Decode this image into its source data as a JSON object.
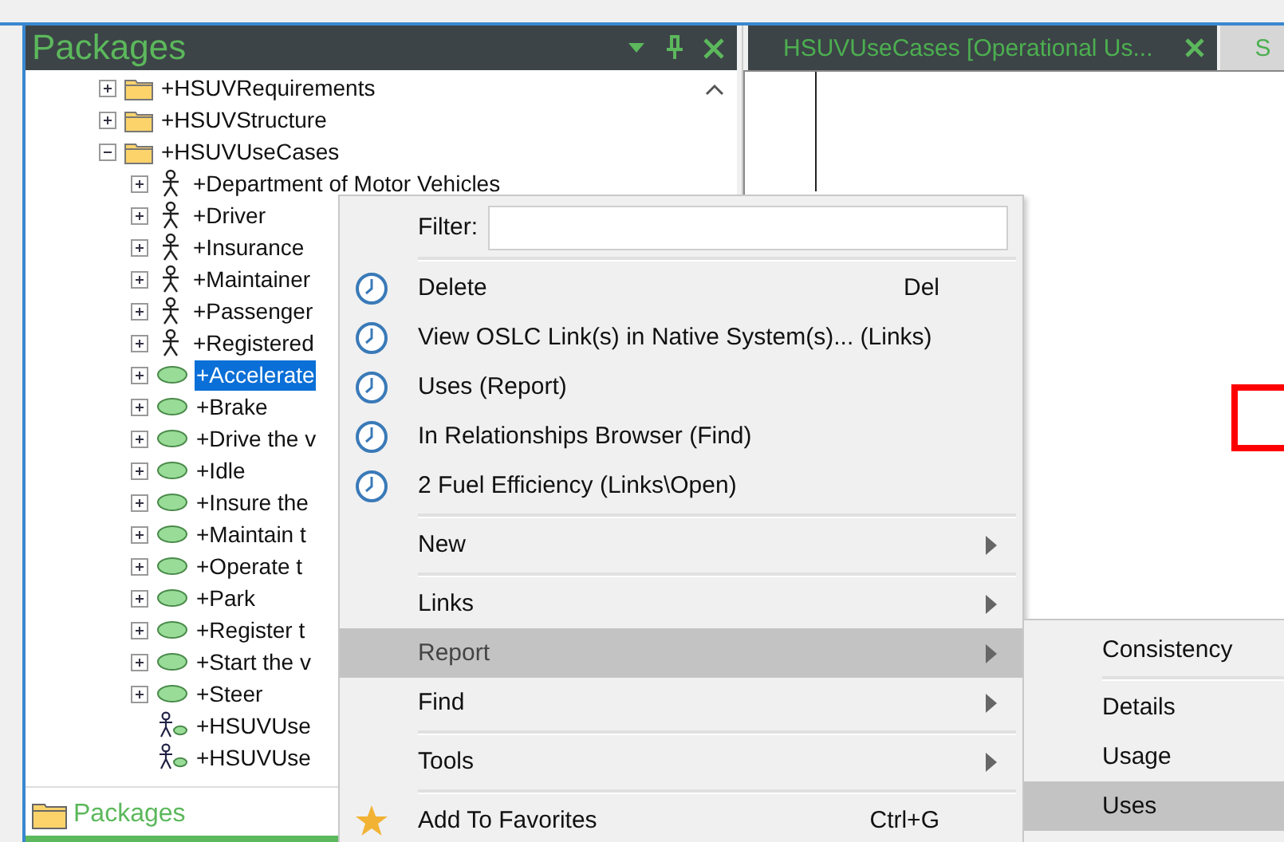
{
  "packages_panel": {
    "title": "Packages",
    "tree": [
      {
        "kind": "package",
        "label": "+HSUVRequirements",
        "expanded": false,
        "selected": false
      },
      {
        "kind": "package",
        "label": "+HSUVStructure",
        "expanded": false,
        "selected": false
      },
      {
        "kind": "package",
        "label": "+HSUVUseCases",
        "expanded": true,
        "selected": false,
        "children": [
          {
            "kind": "actor",
            "label": "+Department of Motor Vehicles",
            "expanded": false,
            "selected": false
          },
          {
            "kind": "actor",
            "label": "+Driver",
            "expanded": false,
            "selected": false
          },
          {
            "kind": "actor",
            "label": "+Insurance",
            "expanded": false,
            "selected": false
          },
          {
            "kind": "actor",
            "label": "+Maintainer",
            "expanded": false,
            "selected": false
          },
          {
            "kind": "actor",
            "label": "+Passenger",
            "expanded": false,
            "selected": false
          },
          {
            "kind": "actor",
            "label": "+Registered",
            "expanded": false,
            "selected": false
          },
          {
            "kind": "usecase",
            "label": "+Accelerate",
            "expanded": false,
            "selected": true
          },
          {
            "kind": "usecase",
            "label": "+Brake",
            "expanded": false,
            "selected": false
          },
          {
            "kind": "usecase",
            "label": "+Drive the v",
            "expanded": false,
            "selected": false
          },
          {
            "kind": "usecase",
            "label": "+Idle",
            "expanded": false,
            "selected": false
          },
          {
            "kind": "usecase",
            "label": "+Insure the",
            "expanded": false,
            "selected": false
          },
          {
            "kind": "usecase",
            "label": "+Maintain t",
            "expanded": false,
            "selected": false
          },
          {
            "kind": "usecase",
            "label": "+Operate t",
            "expanded": false,
            "selected": false
          },
          {
            "kind": "usecase",
            "label": "+Park",
            "expanded": false,
            "selected": false
          },
          {
            "kind": "usecase",
            "label": "+Register t",
            "expanded": false,
            "selected": false
          },
          {
            "kind": "usecase",
            "label": "+Start the v",
            "expanded": false,
            "selected": false
          },
          {
            "kind": "usecase",
            "label": "+Steer",
            "expanded": false,
            "selected": false
          },
          {
            "kind": "diagram",
            "label": "+HSUVUse",
            "selected": false
          },
          {
            "kind": "diagram",
            "label": "+HSUVUse",
            "selected": false
          }
        ]
      }
    ],
    "bottom_tab": "Packages"
  },
  "editor": {
    "tabs": [
      {
        "label": "HSUVUseCases [Operational Us...",
        "selected": true
      },
      {
        "label": "S",
        "selected": false
      }
    ]
  },
  "context_menu": {
    "filter_label": "Filter:",
    "items": [
      {
        "kind": "recent",
        "label": "Delete",
        "shortcut": "Del",
        "selected": false
      },
      {
        "kind": "recent",
        "label": "View OSLC Link(s) in Native System(s)... (Links)",
        "selected": false
      },
      {
        "kind": "recent",
        "label": "Uses (Report)",
        "selected": false
      },
      {
        "kind": "recent",
        "label": "In Relationships Browser (Find)",
        "selected": false
      },
      {
        "kind": "recent",
        "label": "2 Fuel Efficiency (Links\\Open)",
        "selected": false
      },
      {
        "kind": "separator"
      },
      {
        "kind": "submenu",
        "label": "New",
        "selected": false
      },
      {
        "kind": "separator"
      },
      {
        "kind": "submenu",
        "label": "Links",
        "selected": false
      },
      {
        "kind": "submenu",
        "label": "Report",
        "selected": true
      },
      {
        "kind": "submenu",
        "label": "Find",
        "selected": false
      },
      {
        "kind": "separator"
      },
      {
        "kind": "submenu",
        "label": "Tools",
        "selected": false
      },
      {
        "kind": "separator"
      },
      {
        "kind": "favorite",
        "label": "Add To Favorites",
        "shortcut": "Ctrl+G",
        "selected": false
      }
    ]
  },
  "submenu": {
    "items": [
      {
        "kind": "item",
        "label": "Consistency",
        "selected": false
      },
      {
        "kind": "separator"
      },
      {
        "kind": "item",
        "label": "Details",
        "selected": false
      },
      {
        "kind": "item",
        "label": "Usage",
        "selected": false
      },
      {
        "kind": "item",
        "label": "Uses",
        "selected": true
      }
    ]
  }
}
